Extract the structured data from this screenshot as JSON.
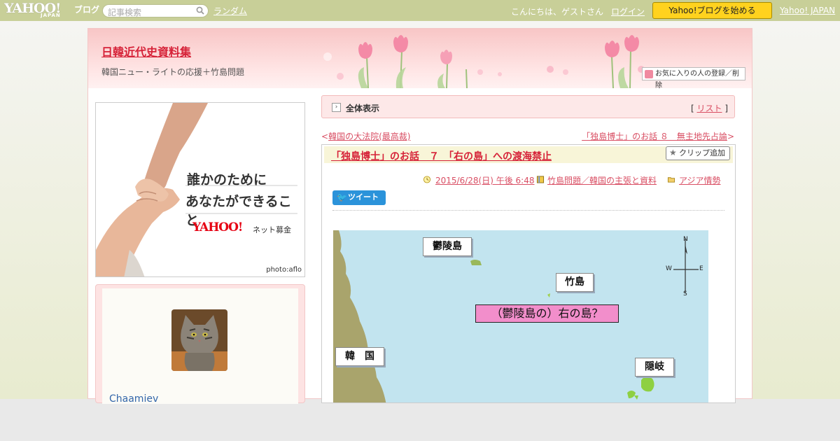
{
  "topbar": {
    "logo_text": "YAHOO!",
    "logo_sub": "JAPAN",
    "logo_service": "ブログ",
    "search_placeholder": "記事検索",
    "random_link": "ランダム",
    "greeting": "こんにちは、ゲストさん",
    "login_link": "ログイン",
    "start_button": "Yahoo!ブログを始める",
    "yahoo_japan_link": "Yahoo! JAPAN"
  },
  "header": {
    "blog_title": "日韓近代史資料集",
    "blog_subtitle": "韓国ニュー・ライトの応援＋竹島問題",
    "favorite_button": "お気に入りの人の登録／削除"
  },
  "ad": {
    "line1": "誰かのために",
    "line2": "あなたができること",
    "logo_text": "YAHOO!",
    "logo_sub": "JAPAN",
    "tagline": "ネット募金",
    "photo_credit": "photo:aflo"
  },
  "profile": {
    "username": "Chaamiev"
  },
  "viewbar": {
    "label": "全体表示",
    "list_open": "[",
    "list_link": "リスト",
    "list_close": "]"
  },
  "nav": {
    "prev_arrow": "<",
    "prev_title": "韓国の大法院(最高裁)",
    "next_title": "「独島博士」のお話 ８　無主地先占論",
    "next_arrow": ">"
  },
  "post": {
    "title": "「独島博士」のお話　７　「右の島」への渡海禁止",
    "clip_button": "クリップ追加",
    "datetime": "2015/6/28(日) 午後 6:48",
    "category": "竹島問題／韓国の主張と資料",
    "folder": "アジア情勢",
    "tweet_button": "ツイート"
  },
  "map": {
    "labels": {
      "ulleungdo": "鬱陵島",
      "takeshima": "竹島",
      "question": "（鬱陵島の）右の島？",
      "korea": "韓　国",
      "oki": "隠岐"
    },
    "compass": {
      "n": "N",
      "s": "S",
      "w": "W",
      "e": "E"
    }
  },
  "colors": {
    "topbar": "#c8cf98",
    "accent_link": "#d94f64",
    "title_red": "#d62238",
    "start_button": "#ffd21e",
    "sea": "#c2e4ef",
    "land": "#a9a46c",
    "question_label": "#f28ecb"
  }
}
